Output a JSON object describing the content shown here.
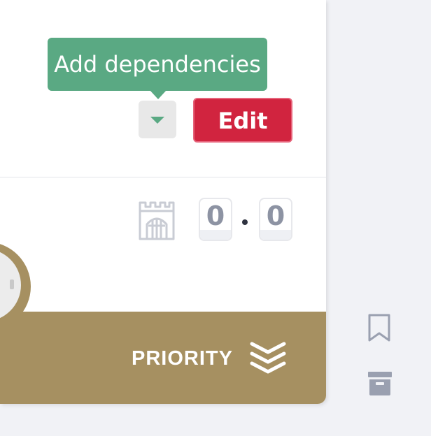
{
  "tooltip": {
    "text": "Add dependencies"
  },
  "actions": {
    "edit_label": "Edit"
  },
  "icons": {
    "dependencies_toggle": "caret-down-icon",
    "castle": "castle-icon",
    "priority": "triple-chevron-down-icon",
    "bookmark": "bookmark-icon",
    "archive": "archive-box-icon"
  },
  "version": {
    "major": "0",
    "separator": ".",
    "minor": "0"
  },
  "priority": {
    "label": "PRIORITY"
  },
  "colors": {
    "tooltip_bg": "#5aa983",
    "edit_bg": "#d1243f",
    "banner_bg": "#a69061",
    "page_bg": "#f1f2f6",
    "icon_gray": "#9aa0b0"
  }
}
